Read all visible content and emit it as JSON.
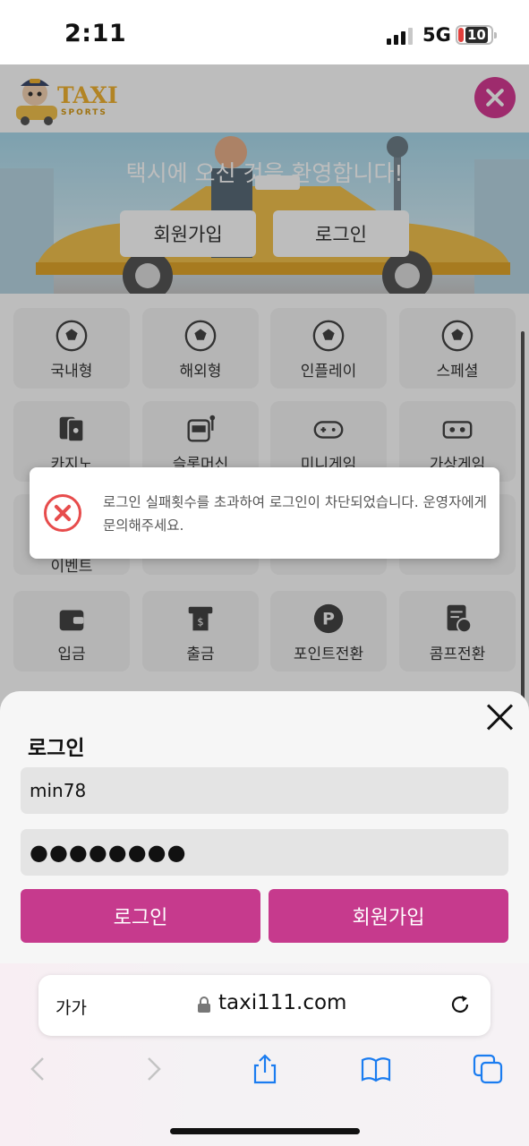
{
  "status_bar": {
    "time": "2:11",
    "network": "5G",
    "battery": "10"
  },
  "site": {
    "logo_title": "TAXI",
    "logo_subtitle": "SPORTS",
    "banner_title": "택시에 오신 것을 환영합니다!",
    "signup_label": "회원가입",
    "login_label": "로그인"
  },
  "menu": {
    "row1": [
      "국내형",
      "해외형",
      "인플레이",
      "스페셜"
    ],
    "row2": [
      "카지노",
      "슬롯머신",
      "미니게임",
      "가상게임"
    ],
    "row3": [
      "이벤트"
    ],
    "row4": [
      "입금",
      "출금",
      "포인트전환",
      "콤프전환"
    ]
  },
  "toast": {
    "message": "로그인 실패횟수를 초과하여 로그인이 차단되었습니다. 운영자에게 문의해주세요."
  },
  "login_sheet": {
    "title": "로그인",
    "username_value": "min78",
    "password_mask": "●●●●●●●●",
    "login_button": "로그인",
    "signup_button": "회원가입"
  },
  "browser": {
    "text_size_label": "가가",
    "url": "taxi111.com"
  },
  "colors": {
    "accent": "#c63a8d",
    "error": "#e74c4c",
    "logo": "#f0b331"
  }
}
